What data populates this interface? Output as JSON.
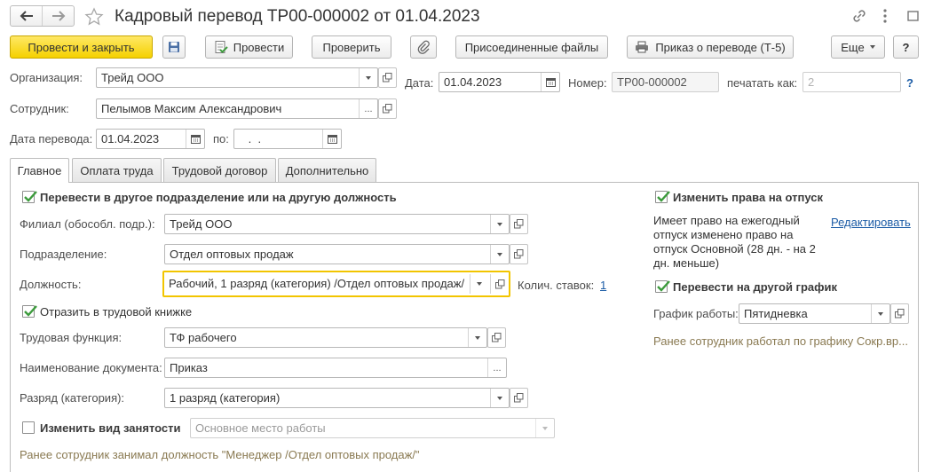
{
  "window": {
    "title": "Кадровый перевод ТР00-000002 от 01.04.2023",
    "back_icon": "arrow-left-icon",
    "forward_icon": "arrow-right-icon",
    "favorite_icon": "star-icon",
    "link_icon": "link-icon",
    "menu_icon": "more-vertical-icon",
    "maximize_icon": "maximize-icon",
    "close_icon": "close-icon"
  },
  "toolbar": {
    "post_close": "Провести и закрыть",
    "save_icon": "save-icon",
    "post": "Провести",
    "check": "Проверить",
    "attach_icon": "paperclip-icon",
    "attached_files": "Присоединенные файлы",
    "print_order": "Приказ о переводе (Т-5)",
    "more": "Еще",
    "help": "?"
  },
  "header": {
    "org_label": "Организация:",
    "org_value": "Трейд ООО",
    "date_label": "Дата:",
    "date_value": "01.04.2023",
    "number_label": "Номер:",
    "number_value": "ТР00-000002",
    "print_as_label": "печатать как:",
    "print_as_placeholder": "2",
    "help_mark": "?",
    "employee_label": "Сотрудник:",
    "employee_value": "Пелымов Максим Александрович",
    "transfer_date_label": "Дата перевода:",
    "transfer_date_value": "01.04.2023",
    "to_label": "по:",
    "to_value": " .  ."
  },
  "tabs": [
    {
      "label": "Главное"
    },
    {
      "label": "Оплата труда"
    },
    {
      "label": "Трудовой договор"
    },
    {
      "label": "Дополнительно"
    }
  ],
  "main": {
    "transfer_check_label": "Перевести в другое подразделение или на другую должность",
    "branch_label": "Филиал (обособл. подр.):",
    "branch_value": "Трейд ООО",
    "department_label": "Подразделение:",
    "department_value": "Отдел оптовых продаж",
    "position_label": "Должность:",
    "position_value": "Рабочий, 1 разряд (категория) /Отдел оптовых продаж/",
    "rates_label": "Колич. ставок:",
    "rates_value": "1",
    "workbook_label": "Отразить в трудовой книжке",
    "labor_function_label": "Трудовая функция:",
    "labor_function_value": "ТФ рабочего",
    "doc_name_label": "Наименование документа:",
    "doc_name_value": "Приказ",
    "grade_label": "Разряд (категория):",
    "grade_value": "1 разряд (категория)",
    "employment_type_label": "Изменить вид занятости",
    "employment_type_value": "Основное место работы",
    "prev_position_note": "Ранее сотрудник занимал должность \"Менеджер /Отдел оптовых продаж/\""
  },
  "right": {
    "vacation_check_label": "Изменить права на отпуск",
    "vacation_info": "Имеет право на ежегодный отпуск изменено право на отпуск Основной (28 дн. - на 2 дн. меньше)",
    "edit_link": "Редактировать",
    "schedule_check_label": "Перевести на другой график",
    "schedule_label": "График работы:",
    "schedule_value": "Пятидневка",
    "prev_schedule_note": "Ранее сотрудник работал по графику Сокр.вр..."
  },
  "colors": {
    "accent_yellow": "#f5d100",
    "link_blue": "#1c5ca6",
    "check_green": "#3c9b3c",
    "note_olive": "#8a7a52"
  }
}
